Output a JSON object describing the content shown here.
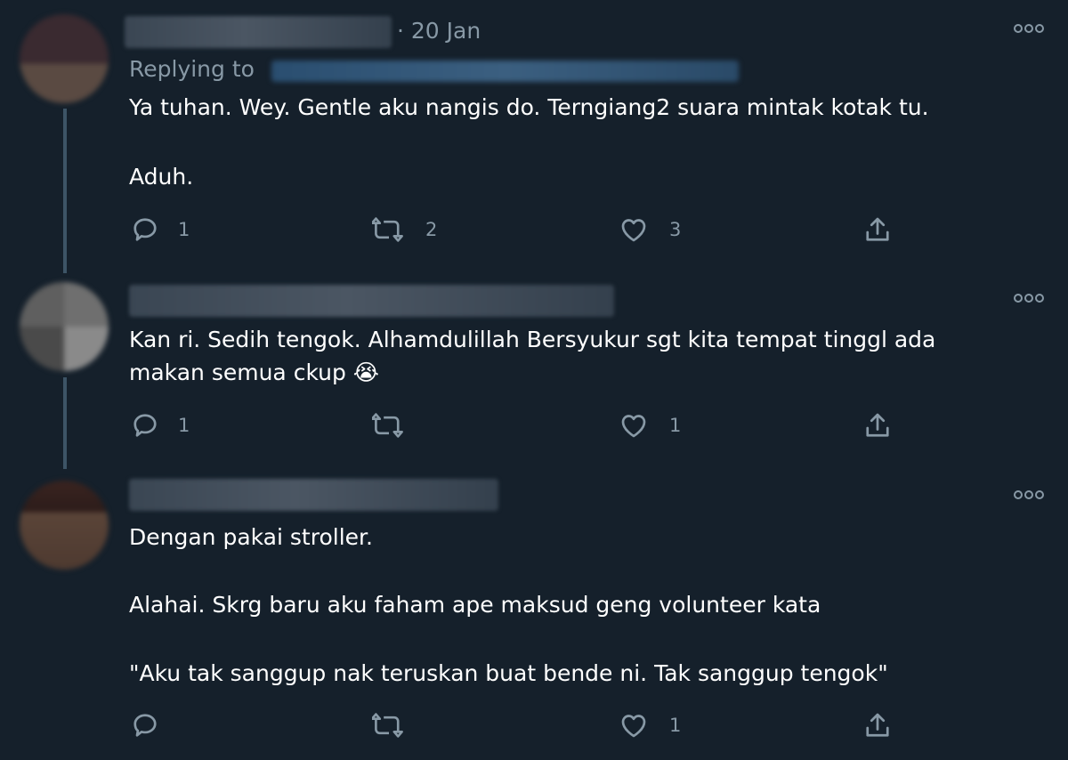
{
  "tweets": [
    {
      "date": "· 20 Jan",
      "replying_to_label": "Replying to",
      "lines": [
        "Ya tuhan. Wey. Gentle aku nangis do. Terngiang2 suara mintak kotak tu.",
        "",
        "Aduh."
      ],
      "counts": {
        "replies": "1",
        "retweets": "2",
        "likes": "3"
      }
    },
    {
      "lines": [
        "Kan ri. Sedih tengok. Alhamdulillah Bersyukur sgt kita tempat tinggl ada",
        "makan semua ckup 😭"
      ],
      "counts": {
        "replies": "1",
        "retweets": "",
        "likes": "1"
      }
    },
    {
      "lines": [
        "Dengan pakai stroller.",
        "",
        "Alahai. Skrg baru aku faham ape maksud geng volunteer kata",
        "",
        "\"Aku tak sanggup nak teruskan buat bende ni. Tak sanggup tengok\""
      ],
      "counts": {
        "replies": "",
        "retweets": "",
        "likes": "1"
      }
    }
  ],
  "colors": {
    "background": "#15202b",
    "text": "#ffffff",
    "secondary": "#8899a6",
    "thread_line": "#3d5466"
  },
  "icons": [
    "reply-icon",
    "retweet-icon",
    "like-icon",
    "share-icon",
    "more-options-icon"
  ]
}
